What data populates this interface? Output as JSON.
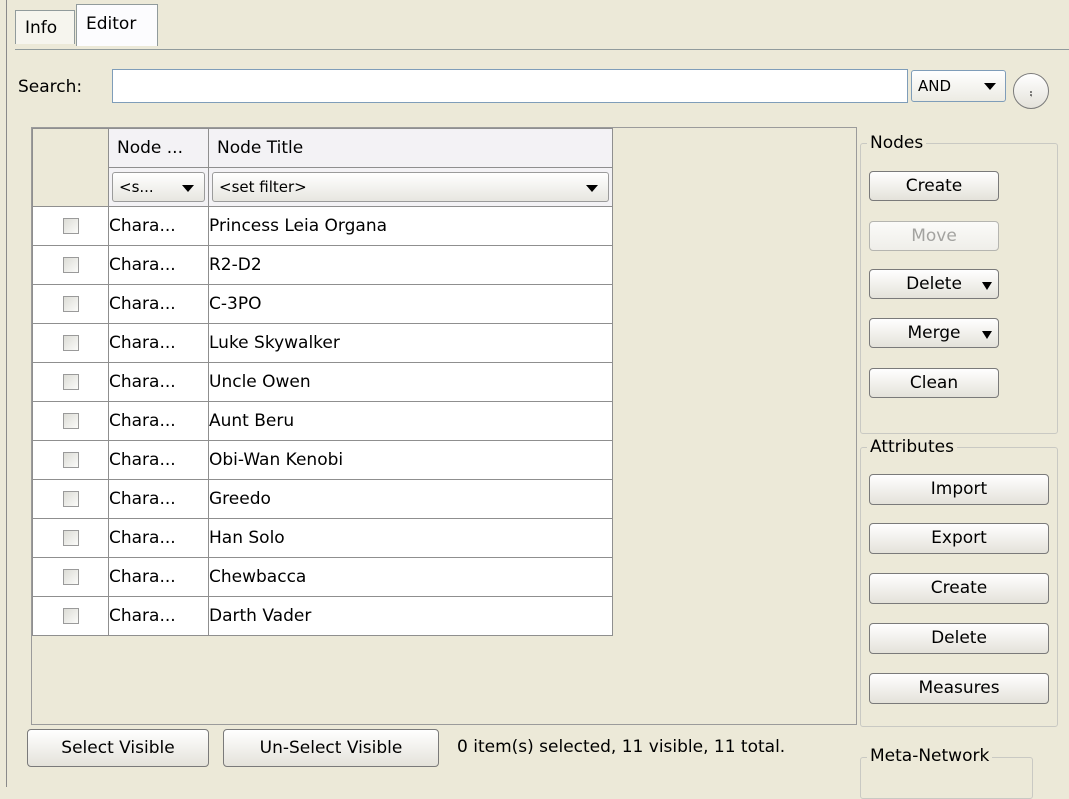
{
  "tabs": [
    {
      "label": "Info"
    },
    {
      "label": "Editor"
    }
  ],
  "search": {
    "label": "Search:",
    "value": "",
    "operator": "AND"
  },
  "table": {
    "columns": [
      "Node ...",
      "Node Title"
    ],
    "filters": [
      "<s...",
      "<set filter>"
    ],
    "rows": [
      {
        "type": "Chara...",
        "title": "Princess Leia Organa"
      },
      {
        "type": "Chara...",
        "title": "R2-D2"
      },
      {
        "type": "Chara...",
        "title": "C-3PO"
      },
      {
        "type": "Chara...",
        "title": "Luke Skywalker"
      },
      {
        "type": "Chara...",
        "title": "Uncle Owen"
      },
      {
        "type": "Chara...",
        "title": "Aunt Beru"
      },
      {
        "type": "Chara...",
        "title": "Obi-Wan Kenobi"
      },
      {
        "type": "Chara...",
        "title": "Greedo"
      },
      {
        "type": "Chara...",
        "title": "Han Solo"
      },
      {
        "type": "Chara...",
        "title": "Chewbacca"
      },
      {
        "type": "Chara...",
        "title": "Darth Vader"
      }
    ]
  },
  "footer": {
    "select_visible": "Select Visible",
    "unselect_visible": "Un-Select Visible",
    "status": "0 item(s) selected, 11 visible, 11 total."
  },
  "nodes_group": {
    "title": "Nodes",
    "create": "Create",
    "move": "Move",
    "delete": "Delete",
    "merge": "Merge",
    "clean": "Clean"
  },
  "attributes_group": {
    "title": "Attributes",
    "import": "Import",
    "export": "Export",
    "create": "Create",
    "delete": "Delete",
    "measures": "Measures"
  },
  "meta_network_group": {
    "title": "Meta-Network"
  },
  "icons": {
    "expand": "double-chevron-down-icon",
    "dropdown": "triangle-down-icon"
  }
}
